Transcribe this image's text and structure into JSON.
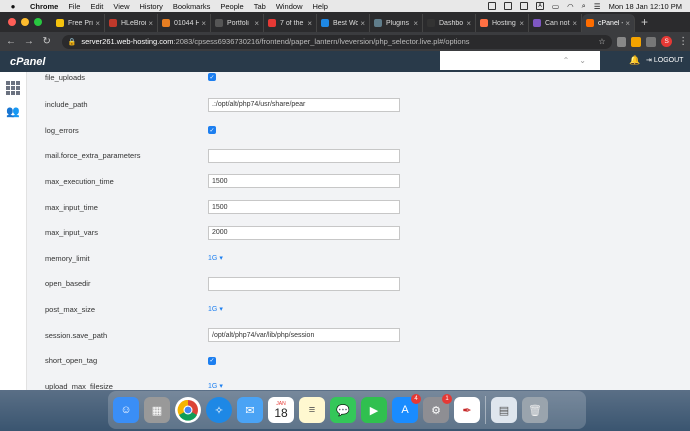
{
  "menubar": {
    "app_name": "Chrome",
    "items": [
      "File",
      "Edit",
      "View",
      "History",
      "Bookmarks",
      "People",
      "Tab",
      "Window",
      "Help"
    ],
    "status_letter": "A",
    "clock": "Mon 18 Jan  12:10 PM"
  },
  "tabs": [
    {
      "title": "Free Pri",
      "color": "#f4c20d"
    },
    {
      "title": "HLeBroi",
      "color": "#c0392b"
    },
    {
      "title": "01044 H",
      "color": "#e67e22"
    },
    {
      "title": "Portfoli",
      "color": "#555555"
    },
    {
      "title": "7 of the",
      "color": "#e53935"
    },
    {
      "title": "Best Wo",
      "color": "#1e88e5"
    },
    {
      "title": "Plugins",
      "color": "#607d8b"
    },
    {
      "title": "Dashbo",
      "color": "#333333"
    },
    {
      "title": "Hosting",
      "color": "#ff7043"
    },
    {
      "title": "Can not",
      "color": "#7e57c2"
    },
    {
      "title": "cPanel -",
      "color": "#ff6d00",
      "active": true
    }
  ],
  "address": {
    "host": "server261.web-hosting.com",
    "path": ":2083/cpsess6936730216/frontend/paper_lantern/lveversion/php_selector.live.pl#/options"
  },
  "profile_initial": "S",
  "cpanel": {
    "logo": "cPanel",
    "logout": "LOGOUT"
  },
  "options": [
    {
      "name": "file_uploads",
      "type": "checkbox",
      "checked": true
    },
    {
      "name": "include_path",
      "type": "text",
      "value": ".:/opt/alt/php74/usr/share/pear"
    },
    {
      "name": "log_errors",
      "type": "checkbox",
      "checked": true
    },
    {
      "name": "mail.force_extra_parameters",
      "type": "text",
      "value": ""
    },
    {
      "name": "max_execution_time",
      "type": "text",
      "value": "1500"
    },
    {
      "name": "max_input_time",
      "type": "text",
      "value": "1500"
    },
    {
      "name": "max_input_vars",
      "type": "text",
      "value": "2000"
    },
    {
      "name": "memory_limit",
      "type": "select",
      "value": "1G"
    },
    {
      "name": "open_basedir",
      "type": "text",
      "value": ""
    },
    {
      "name": "post_max_size",
      "type": "select",
      "value": "1G"
    },
    {
      "name": "session.save_path",
      "type": "text",
      "value": "/opt/alt/php74/var/lib/php/session"
    },
    {
      "name": "short_open_tag",
      "type": "checkbox",
      "checked": true
    },
    {
      "name": "upload_max_filesize",
      "type": "select",
      "value": "1G"
    }
  ],
  "dock": {
    "calendar_month": "JAN",
    "calendar_day": "18",
    "appstore_badge": "4",
    "settings_badge": "1"
  },
  "colors": {
    "accent": "#1d7ff0",
    "cpanel_header": "#293a4a"
  }
}
